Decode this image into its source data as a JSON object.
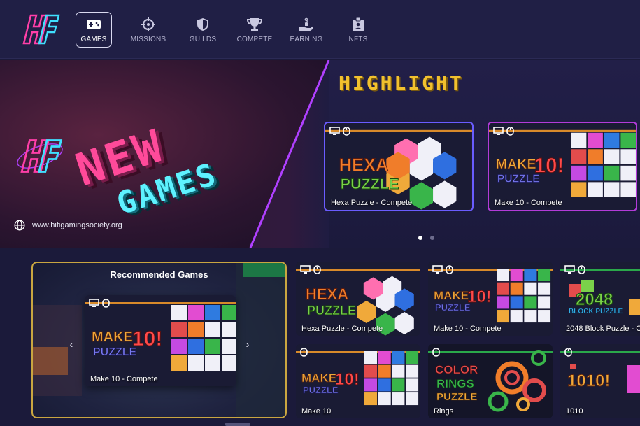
{
  "nav": {
    "items": [
      {
        "label": "GAMES",
        "icon": "gamepad-icon",
        "active": true
      },
      {
        "label": "MISSIONS",
        "icon": "crosshair-icon",
        "active": false
      },
      {
        "label": "GUILDS",
        "icon": "shield-icon",
        "active": false
      },
      {
        "label": "COMPETE",
        "icon": "trophy-icon",
        "active": false
      },
      {
        "label": "EARNING",
        "icon": "money-hand-icon",
        "active": false
      },
      {
        "label": "NFTS",
        "icon": "badge-icon",
        "active": false
      }
    ]
  },
  "hero": {
    "banner_line1": "NEW",
    "banner_line2": "GAMES",
    "site_url": "www.hifigamingsociety.org",
    "highlight_title": "HIGHLIGHT",
    "highlight_cards": [
      {
        "label": "Hexa Puzzle - Compete",
        "art": "hexa-puzzle"
      },
      {
        "label": "Make 10 - Compete",
        "art": "make-10"
      }
    ],
    "carousel_dots": 2,
    "active_dot": 0
  },
  "recommended": {
    "title": "Recommended Games",
    "card_label": "Make 10 - Compete",
    "prev": "‹",
    "next": "›"
  },
  "grid": {
    "row1": [
      {
        "label": "Hexa Puzzle - Compete",
        "art": "hexa-puzzle"
      },
      {
        "label": "Make 10 - Compete",
        "art": "make-10"
      },
      {
        "label": "2048 Block Puzzle - C",
        "art": "2048"
      }
    ],
    "row2": [
      {
        "label": "Make 10",
        "art": "make-10"
      },
      {
        "label": "Rings",
        "art": "color-rings"
      },
      {
        "label": "1010",
        "art": "1010"
      }
    ]
  },
  "art_text": {
    "hexa_l1": "HEXA",
    "hexa_l2": "PUZZLE",
    "make_l1": "MAKE",
    "make_l2": "PUZZLE",
    "make_ten": "10!",
    "make_grid": [
      "4",
      "6",
      "2",
      "5",
      "3",
      "",
      "1",
      "3",
      "9",
      "7",
      "",
      ""
    ],
    "hex_nums": [
      "32",
      "8",
      "16",
      "4",
      "1",
      "2",
      "1",
      "8"
    ],
    "b2048_l1": "2048",
    "b2048_l2": "BLOCK PUZZLE",
    "rings_l1": "COLOR",
    "rings_l2": "RINGS",
    "rings_l3": "PUZZLE",
    "t1010": "1010!"
  },
  "colors": {
    "accent_gold": "#f2c12e",
    "nav_bg": "#201f45",
    "page_bg": "#1b1a3a",
    "pink": "#ff4a9a",
    "cyan": "#5ef2ff"
  }
}
